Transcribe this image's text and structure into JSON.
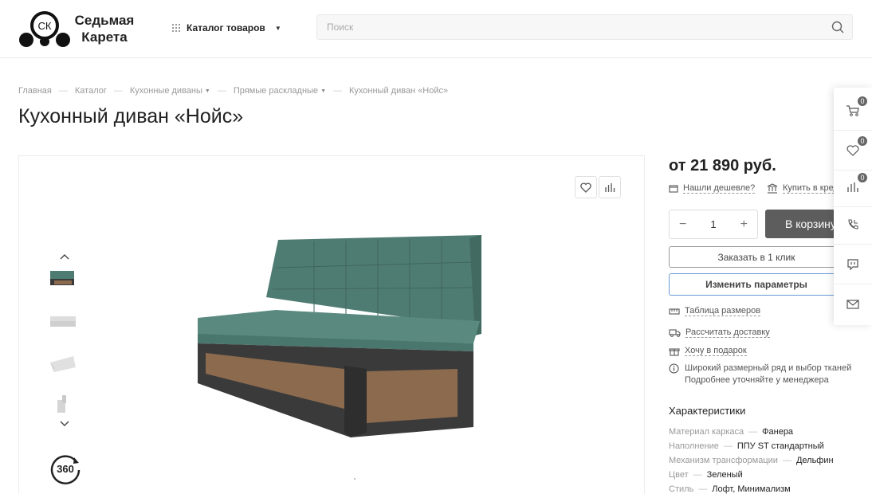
{
  "header": {
    "logo_line1": "Седьмая",
    "logo_line2": "Карета",
    "logo_mark_text": "СК",
    "catalog_label": "Каталог товаров",
    "search_placeholder": "Поиск"
  },
  "breadcrumb": [
    {
      "label": "Главная"
    },
    {
      "label": "Каталог"
    },
    {
      "label": "Кухонные диваны"
    },
    {
      "label": "Прямые раскладные"
    },
    {
      "label": "Кухонный диван «Нойс»"
    }
  ],
  "page_title": "Кухонный диван «Нойс»",
  "gallery": {
    "icon_360_label": "360",
    "thumbs": [
      "thumb-1",
      "thumb-2",
      "thumb-3",
      "thumb-4"
    ]
  },
  "buy": {
    "price": "от 21 890 руб.",
    "cheaper_link": "Нашли дешевле?",
    "credit_link": "Купить в кред",
    "quantity": "1",
    "minus": "−",
    "plus": "+",
    "cart_button": "В корзину",
    "one_click_button": "Заказать в 1 клик",
    "params_button": "Изменить параметры",
    "size_table_link": "Таблица размеров",
    "delivery_link": "Рассчитать доставку",
    "gift_link": "Хочу в подарок",
    "info_line1": "Широкий размерный ряд и выбор тканей",
    "info_line2": "Подробнее уточняйте у менеджера"
  },
  "characteristics": {
    "title": "Характеристики",
    "rows": [
      {
        "name": "Материал каркаса",
        "value": "Фанера"
      },
      {
        "name": "Наполнение",
        "value": "ППУ ST стандартный"
      },
      {
        "name": "Механизм трансформации",
        "value": "Дельфин"
      },
      {
        "name": "Цвет",
        "value": "Зеленый"
      },
      {
        "name": "Стиль",
        "value": "Лофт, Минимализм"
      }
    ],
    "separator": "—"
  },
  "side_panel": {
    "cart_count": "0",
    "favorites_count": "0",
    "compare_count": "0"
  },
  "colors": {
    "accent_blue": "#6a9bd8",
    "cart_button_bg": "#5d5d5d",
    "sofa_upholstery": "#4f7c72",
    "sofa_frame": "#3a3a3a",
    "sofa_wood": "#8b6a4e"
  }
}
